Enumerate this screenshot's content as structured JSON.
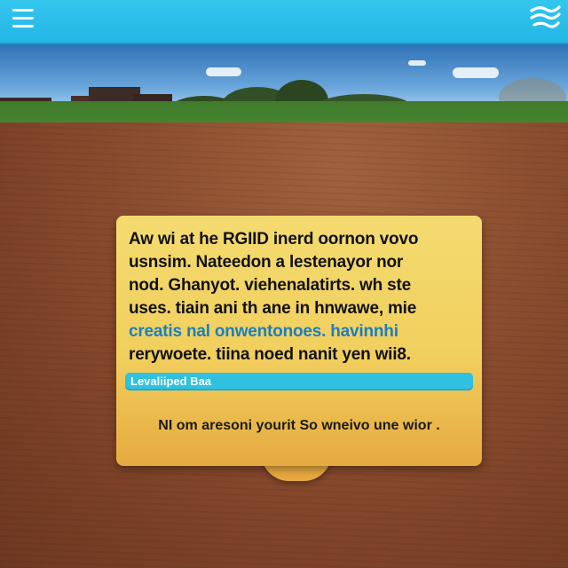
{
  "dialog": {
    "lines": [
      "Aw wi at he RGIID inerd oornon vovo",
      "usnsim. Nateedon a lestenayor nor",
      "nod. Ghanyot. viehenalatirts. wh ste",
      "uses. tiain ani th ane in hnwawe, mie",
      "creatis nal onwentonoes. havinnhi",
      "rerywoete. tiina noed nanit yen wii8."
    ],
    "progress_label": "Levaliiped Baa",
    "footer_text": "NI om aresoni yourit So wneivo une wior ."
  },
  "icons": {
    "menu": "menu-icon",
    "logo": "wave-logo-icon"
  },
  "colors": {
    "topbar": "#22b6e4",
    "card": "#f1cf5e",
    "progress": "#2fc1df",
    "accent_text": "#1a7fc0"
  }
}
